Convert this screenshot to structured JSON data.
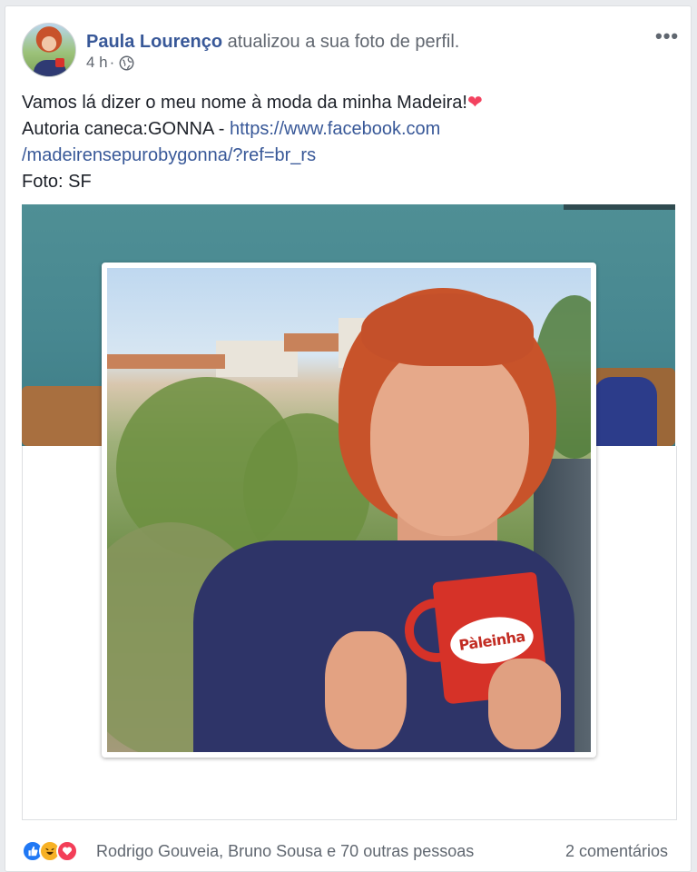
{
  "post": {
    "author": "Paula Lourenço",
    "action": "atualizou a sua foto de perfil.",
    "time": "4 h",
    "separator": "·",
    "audience_icon": "globe-icon",
    "more_icon": "more-options-icon",
    "text_line1": "Vamos lá dizer o meu nome à moda da minha Madeira!",
    "text_line2_prefix": "Autoria caneca:GONNA - ",
    "link_line1": "https://www.facebook.com",
    "link_line2": "/madeirensepurobygonna/?ref=br_rs",
    "text_line3": "Foto: SF",
    "emoji": "heart-emoji"
  },
  "photo": {
    "mug_text": "Pàleinha"
  },
  "footer": {
    "reaction_icons": [
      "like-reaction-icon",
      "haha-reaction-icon",
      "love-reaction-icon"
    ],
    "reaction_names": "Rodrigo Gouveia, Bruno Sousa e 70 outras pessoas",
    "comments": "2 comentários"
  },
  "colors": {
    "link": "#385898",
    "like": "#2078f4",
    "haha": "#f7b125",
    "love": "#f33e58"
  }
}
